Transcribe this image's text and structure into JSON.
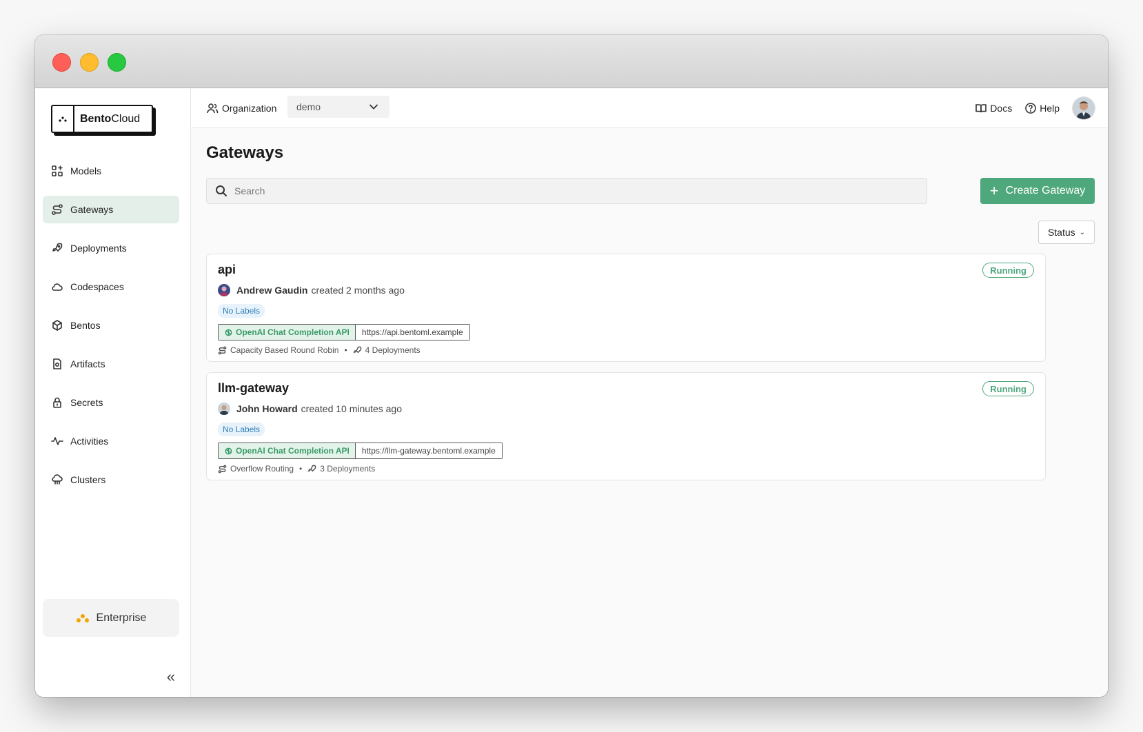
{
  "brand": {
    "name_bold": "Bento",
    "name_rest": "Cloud"
  },
  "sidebar": {
    "items": [
      {
        "label": "Models",
        "icon": "grid-icon"
      },
      {
        "label": "Gateways",
        "icon": "route-icon",
        "active": true
      },
      {
        "label": "Deployments",
        "icon": "rocket-icon"
      },
      {
        "label": "Codespaces",
        "icon": "cloud-icon"
      },
      {
        "label": "Bentos",
        "icon": "box-icon"
      },
      {
        "label": "Artifacts",
        "icon": "file-icon"
      },
      {
        "label": "Secrets",
        "icon": "lock-icon"
      },
      {
        "label": "Activities",
        "icon": "activity-icon"
      },
      {
        "label": "Clusters",
        "icon": "cloud-server-icon"
      }
    ],
    "enterprise_label": "Enterprise",
    "collapse_glyph": "«"
  },
  "topbar": {
    "org_label": "Organization",
    "org_value": "demo",
    "docs_label": "Docs",
    "help_label": "Help"
  },
  "main": {
    "title": "Gateways",
    "search_placeholder": "Search",
    "create_label": "Create Gateway",
    "status_filter_label": "Status"
  },
  "gateways": [
    {
      "name": "api",
      "status": "Running",
      "creator": "Andrew Gaudin",
      "created_text": "created 2 months ago",
      "labels": "No Labels",
      "api_type": "OpenAI Chat Completion API",
      "url": "https://api.bentoml.example",
      "routing": "Capacity Based Round Robin",
      "deployments": "4 Deployments"
    },
    {
      "name": "llm-gateway",
      "status": "Running",
      "creator": "John Howard",
      "created_text": "created 10 minutes ago",
      "labels": "No Labels",
      "api_type": "OpenAI Chat Completion API",
      "url": "https://llm-gateway.bentoml.example",
      "routing": "Overflow Routing",
      "deployments": "3 Deployments"
    }
  ],
  "colors": {
    "accent": "#4fa87c",
    "active_nav_bg": "#e5efe9",
    "label_blue": "#2e7fb8"
  }
}
